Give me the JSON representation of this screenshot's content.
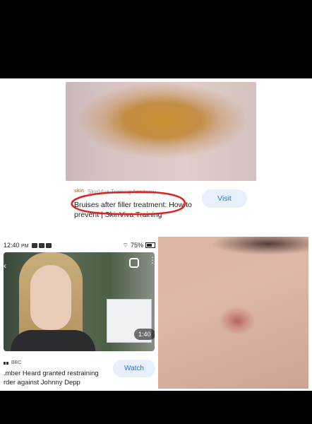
{
  "result1": {
    "source_name": "SkinViva Training Academy",
    "source_logo_text": "skin",
    "title": "Bruises after filler treatment: How to prevent | SkinViva Training",
    "button_label": "Visit"
  },
  "result2": {
    "status_time": "12:40",
    "status_ampm": "PM",
    "battery": "75%",
    "duration": "1:40",
    "source_name": "BBC",
    "title": ".mber Heard granted restraining rder against Johnny Depp",
    "button_label": "Watch"
  },
  "colors": {
    "button_bg": "#e8f0fe",
    "button_text": "#1a73e8",
    "highlight_circle": "#e0201c"
  }
}
